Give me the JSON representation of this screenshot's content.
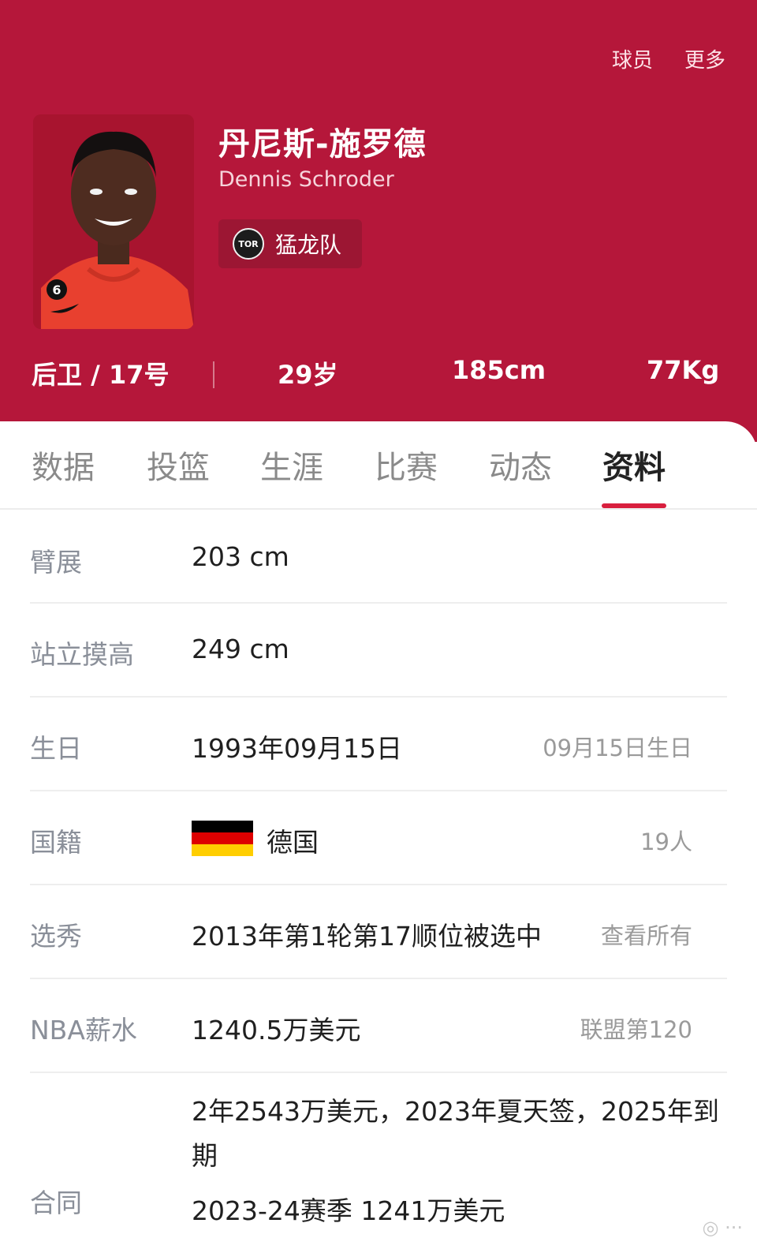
{
  "top_nav": {
    "players": "球员",
    "more": "更多"
  },
  "player": {
    "name_cn": "丹尼斯-施罗德",
    "name_en": "Dennis Schroder",
    "team": "猛龙队",
    "team_logo_text": "TOR",
    "jersey_on_photo": "6",
    "position_number": "后卫 / 17号",
    "age": "29岁",
    "height": "185cm",
    "weight": "77Kg"
  },
  "tabs": [
    "数据",
    "投篮",
    "生涯",
    "比赛",
    "动态",
    "资料"
  ],
  "active_tab": "资料",
  "info": {
    "wingspan": {
      "label": "臂展",
      "value": "203 cm"
    },
    "standing_reach": {
      "label": "站立摸高",
      "value": "249 cm"
    },
    "birthday": {
      "label": "生日",
      "value": "1993年09月15日",
      "extra": "09月15日生日"
    },
    "nationality": {
      "label": "国籍",
      "value": "德国",
      "extra": "19人"
    },
    "draft": {
      "label": "选秀",
      "value": "2013年第1轮第17顺位被选中",
      "extra": "查看所有"
    },
    "salary": {
      "label": "NBA薪水",
      "value": "1240.5万美元",
      "extra": "联盟第120"
    },
    "contract": {
      "label": "合同",
      "line1": "2年2543万美元，2023年夏天签，2025年到",
      "line2": "期",
      "line3": "2023-24赛季 1241万美元"
    }
  },
  "colors": {
    "header": "#b5173a",
    "accent": "#d81f3e",
    "flag": [
      "#000000",
      "#dd0000",
      "#ffce00"
    ]
  }
}
